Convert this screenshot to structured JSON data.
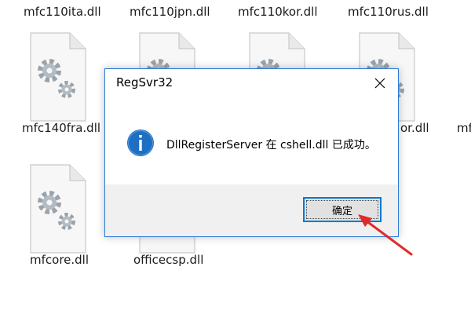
{
  "files": {
    "top_row": [
      {
        "name": "mfc110ita.dll"
      },
      {
        "name": "mfc110jpn.dll"
      },
      {
        "name": "mfc110kor.dll"
      },
      {
        "name": "mfc110rus.dll"
      }
    ],
    "middle_row": [
      {
        "name": "mfc140fra.dll"
      },
      {
        "name_partial": "or.dll"
      },
      {
        "name_partial": "mf"
      }
    ],
    "bottom_row": [
      {
        "name": "mfcore.dll"
      },
      {
        "name": "officecsp.dll"
      }
    ],
    "icon": "dll-gear-file-icon"
  },
  "dialog": {
    "title": "RegSvr32",
    "message": "DllRegisterServer 在 cshell.dll 已成功。",
    "ok_label": "确定",
    "icon": "info-icon",
    "close_icon": "close-icon"
  },
  "colors": {
    "accent": "#0078d7",
    "info_icon": "#1e6fc2",
    "annotation_arrow": "#e02a2a",
    "footer_bg": "#f0f0f0"
  }
}
